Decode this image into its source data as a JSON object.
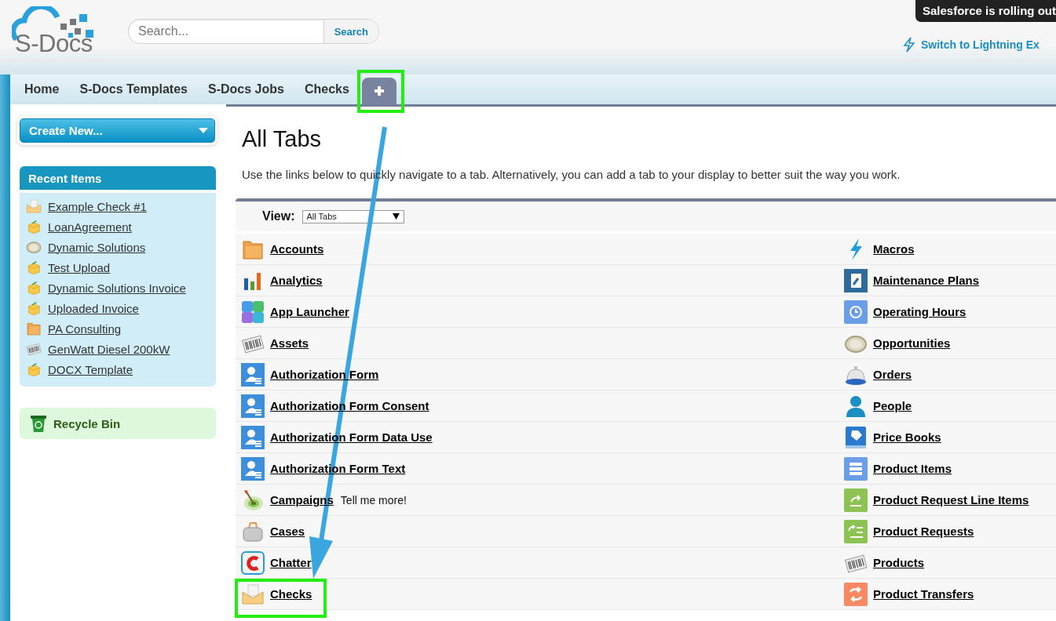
{
  "header": {
    "logo_text": "S-Docs",
    "search": {
      "placeholder": "Search...",
      "button": "Search"
    },
    "notice": "Salesforce is rolling out",
    "switch_link": "Switch to Lightning Ex"
  },
  "tabs": [
    {
      "label": "Home",
      "kind": "text"
    },
    {
      "label": "S-Docs Templates",
      "kind": "text"
    },
    {
      "label": "S-Docs Jobs",
      "kind": "text"
    },
    {
      "label": "Checks",
      "kind": "text"
    },
    {
      "kind": "add"
    }
  ],
  "sidebar": {
    "create_button": "Create New...",
    "recent_title": "Recent Items",
    "recent_items": [
      {
        "label": "Example Check #1",
        "kind": "envelope"
      },
      {
        "label": "LoanAgreement",
        "kind": "package"
      },
      {
        "label": "Dynamic Solutions",
        "kind": "coin"
      },
      {
        "label": "Test Upload",
        "kind": "package"
      },
      {
        "label": "Dynamic Solutions Invoice",
        "kind": "package"
      },
      {
        "label": "Uploaded Invoice",
        "kind": "package"
      },
      {
        "label": "PA Consulting",
        "kind": "folder"
      },
      {
        "label": "GenWatt Diesel 200kW",
        "kind": "barcode"
      },
      {
        "label": "DOCX Template",
        "kind": "package"
      }
    ],
    "recycle_bin": "Recycle Bin"
  },
  "main": {
    "title": "All Tabs",
    "description_before": "Use the links below to quickly navigate to a tab. Alternatively, you can ",
    "description_link": "add a tab",
    "description_after": " to your display to better suit the way you work.",
    "view_label": "View:",
    "view_value": "All Tabs",
    "left_column": [
      {
        "label": "Accounts",
        "kind": "folder"
      },
      {
        "label": "Analytics",
        "kind": "chart"
      },
      {
        "label": "App Launcher",
        "kind": "grid"
      },
      {
        "label": "Assets",
        "kind": "barcode"
      },
      {
        "label": "Authorization Form",
        "kind": "person-form"
      },
      {
        "label": "Authorization Form Consent",
        "kind": "person-form"
      },
      {
        "label": "Authorization Form Data Use",
        "kind": "person-form"
      },
      {
        "label": "Authorization Form Text",
        "kind": "person-form"
      },
      {
        "label": "Campaigns",
        "kind": "target",
        "extra": "Tell me more!"
      },
      {
        "label": "Cases",
        "kind": "case"
      },
      {
        "label": "Chatter",
        "kind": "chatter"
      },
      {
        "label": "Checks",
        "kind": "envelope"
      }
    ],
    "right_column": [
      {
        "label": "Macros",
        "kind": "bolt"
      },
      {
        "label": "Maintenance Plans",
        "kind": "wrench"
      },
      {
        "label": "Operating Hours",
        "kind": "clock"
      },
      {
        "label": "Opportunities",
        "kind": "coin"
      },
      {
        "label": "Orders",
        "kind": "bell"
      },
      {
        "label": "People",
        "kind": "person"
      },
      {
        "label": "Price Books",
        "kind": "book"
      },
      {
        "label": "Product Items",
        "kind": "table"
      },
      {
        "label": "Product Request Line Items",
        "kind": "request-line"
      },
      {
        "label": "Product Requests",
        "kind": "request"
      },
      {
        "label": "Products",
        "kind": "barcode"
      },
      {
        "label": "Product Transfers",
        "kind": "transfer"
      }
    ]
  }
}
